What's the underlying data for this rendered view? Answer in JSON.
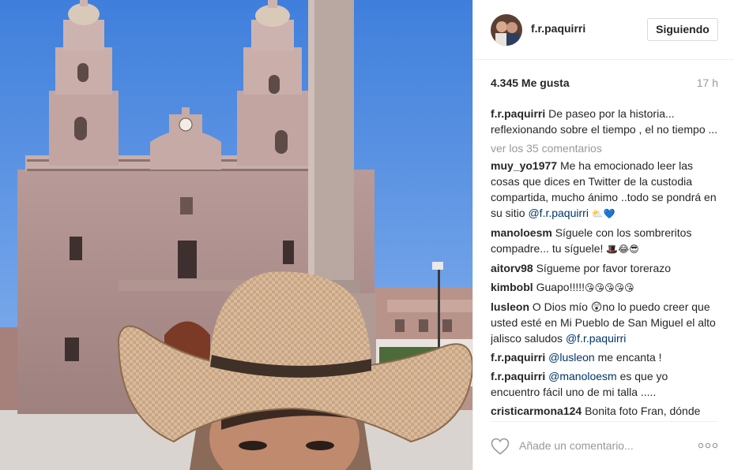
{
  "post": {
    "username": "f.r.paquirri",
    "follow_label": "Siguiendo",
    "likes": "4.345 Me gusta",
    "time": "17 h"
  },
  "caption": {
    "user": "f.r.paquirri",
    "text": "De paseo por la historia... reflexionando sobre el tiempo , el no tiempo ..."
  },
  "view_all_label": "ver los 35 comentarios",
  "comments": [
    {
      "user": "muy_yo1977",
      "text": "Me ha emocionado leer las cosas que dices en Twitter de la custodia compartida, mucho ánimo ..todo se pondrá en su sitio",
      "mention": "@f.r.paquirri",
      "emoji": "⛅💙"
    },
    {
      "user": "manoloesm",
      "text": "Síguele con los sombreritos compadre... tu síguele!",
      "mention": "",
      "emoji": "🎩😂😎"
    },
    {
      "user": "aitorv98",
      "text": "Sígueme por favor torerazo",
      "mention": "",
      "emoji": ""
    },
    {
      "user": "kimbobl",
      "text": "Guapo!!!!!",
      "mention": "",
      "emoji": "😘😘😘😘😘"
    },
    {
      "user": "lusleon",
      "text": "O Dios mío 😲no lo puedo creer que usted esté en Mi Pueblo de San Miguel el alto jalisco saludos",
      "mention": "@f.r.paquirri",
      "emoji": ""
    },
    {
      "user": "f.r.paquirri",
      "text": "me encanta !",
      "mention_first": "@lusleon",
      "mention": "",
      "emoji": ""
    },
    {
      "user": "f.r.paquirri",
      "text": "es que yo encuentro fácil uno de mi talla .....",
      "mention_first": "@manoloesm",
      "mention": "",
      "emoji": ""
    },
    {
      "user": "cristicarmona124",
      "text": "Bonita foto Fran, dónde",
      "mention": "",
      "emoji": ""
    }
  ],
  "footer": {
    "placeholder": "Añade un comentario...",
    "more_glyph": "○○○"
  },
  "colors": {
    "sky": "#5b8fe0",
    "link": "#003569",
    "muted": "#999999",
    "border": "#efefef"
  },
  "icons": {
    "like": "heart-outline-icon",
    "more": "more-options-icon"
  }
}
